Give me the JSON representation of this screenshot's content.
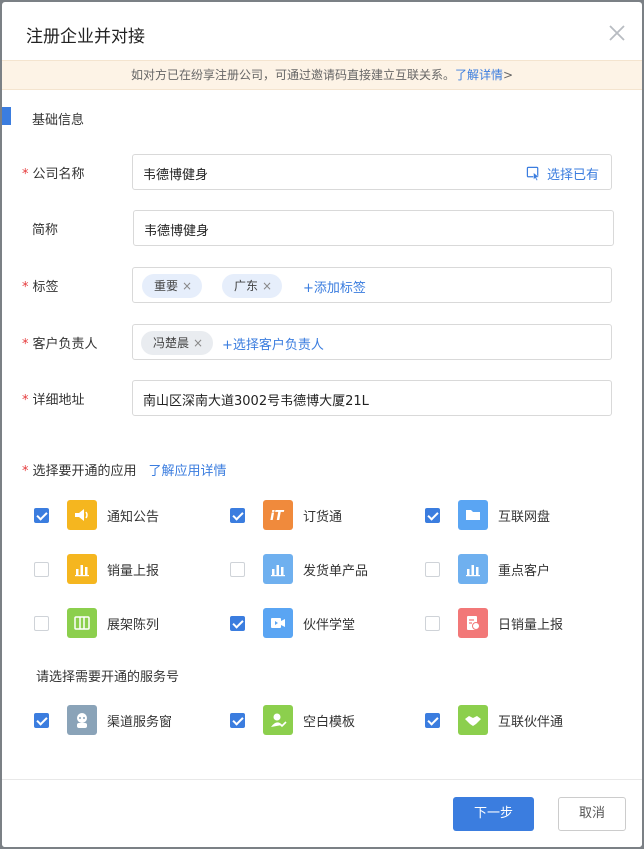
{
  "dialog": {
    "title": "注册企业并对接",
    "notice": "如对方已在纷享注册公司，可通过邀请码直接建立互联关系。",
    "notice_link": "了解详情",
    "notice_arrow": ">"
  },
  "basic": {
    "section_title": "基础信息",
    "company": {
      "label": "公司名称",
      "value": "韦德博健身",
      "pick_label": "选择已有"
    },
    "short_name": {
      "label": "简称",
      "value": "韦德博健身"
    },
    "tags": {
      "label": "标签",
      "items": [
        "重要",
        "广东"
      ],
      "add_label": "添加标签"
    },
    "owner": {
      "label": "客户负责人",
      "items": [
        "冯楚晨"
      ],
      "add_label": "选择客户负责人"
    },
    "address": {
      "label": "详细地址",
      "value": "南山区深南大道3002号韦德博大厦21L"
    }
  },
  "apps": {
    "title": "选择要开通的应用",
    "link": "了解应用详情",
    "items": [
      {
        "label": "通知公告",
        "checked": true,
        "icon": "speaker-icon",
        "color": "#f5b61f"
      },
      {
        "label": "订货通",
        "checked": true,
        "icon": "order-icon",
        "color": "#f08a3c"
      },
      {
        "label": "互联网盘",
        "checked": true,
        "icon": "folder-icon",
        "color": "#5aa5f3"
      },
      {
        "label": "销量上报",
        "checked": false,
        "icon": "bar-chart-icon",
        "color": "#f5b61f"
      },
      {
        "label": "发货单产品",
        "checked": false,
        "icon": "bar-chart-icon",
        "color": "#6fb0ef"
      },
      {
        "label": "重点客户",
        "checked": false,
        "icon": "bar-chart-icon",
        "color": "#6fb0ef"
      },
      {
        "label": "展架陈列",
        "checked": false,
        "icon": "shelf-icon",
        "color": "#8ccf4d"
      },
      {
        "label": "伙伴学堂",
        "checked": true,
        "icon": "video-icon",
        "color": "#5aa5f3"
      },
      {
        "label": "日销量上报",
        "checked": false,
        "icon": "report-icon",
        "color": "#f27878"
      }
    ]
  },
  "services": {
    "title": "请选择需要开通的服务号",
    "items": [
      {
        "label": "渠道服务窗",
        "checked": true,
        "icon": "robot-icon",
        "color": "#8aa3b8"
      },
      {
        "label": "空白模板",
        "checked": true,
        "icon": "user-check-icon",
        "color": "#8ccf4d"
      },
      {
        "label": "互联伙伴通",
        "checked": true,
        "icon": "handshake-icon",
        "color": "#8ccf4d"
      }
    ]
  },
  "footer": {
    "next_label": "下一步",
    "cancel_label": "取消"
  }
}
